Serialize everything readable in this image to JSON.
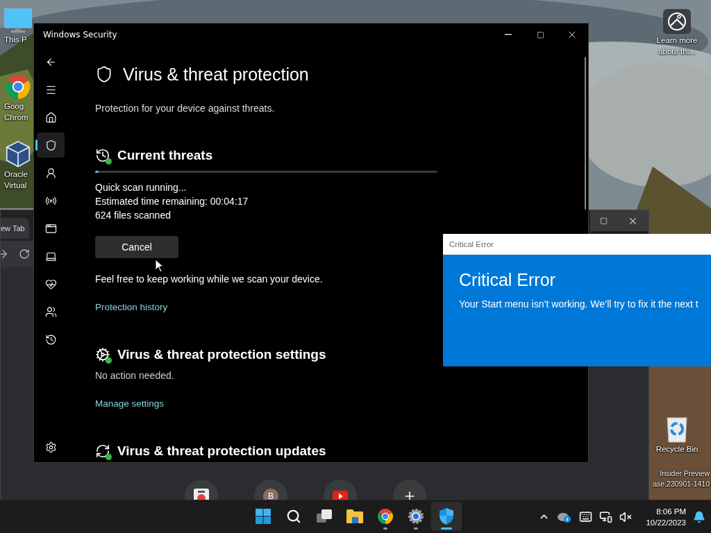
{
  "desktop": {
    "icons": [
      {
        "kind": "pc",
        "lines": [
          "This P"
        ]
      },
      {
        "kind": "chrome",
        "lines": [
          "Goog",
          "Chrom"
        ]
      },
      {
        "kind": "virtualbox",
        "lines": [
          "Oracle",
          "Virtual"
        ]
      },
      {
        "kind": "learn",
        "lines": [
          "Learn more",
          "about thi..."
        ]
      },
      {
        "kind": "recycle",
        "lines": [
          "Recycle Bin"
        ]
      }
    ],
    "watermark": [
      "Insider Preview",
      "ase.230901-1410"
    ]
  },
  "browser": {
    "tab": "ew Tab",
    "tiles": [
      {
        "kind": "site"
      },
      {
        "kind": "letter",
        "letter": "B"
      },
      {
        "kind": "video"
      },
      {
        "kind": "add"
      }
    ]
  },
  "security": {
    "title": "Windows Security",
    "nav": [
      {
        "kind": "back",
        "selected": false
      },
      {
        "kind": "menu",
        "selected": false
      },
      {
        "kind": "home",
        "selected": false
      },
      {
        "kind": "shield",
        "selected": true
      },
      {
        "kind": "account",
        "selected": false
      },
      {
        "kind": "network",
        "selected": false
      },
      {
        "kind": "app",
        "selected": false
      },
      {
        "kind": "device",
        "selected": false
      },
      {
        "kind": "health",
        "selected": false
      },
      {
        "kind": "family",
        "selected": false
      },
      {
        "kind": "history",
        "selected": false
      },
      {
        "kind": "settings",
        "selected": false
      }
    ],
    "heading": "Virus & threat protection",
    "subtitle": "Protection for your device against threats.",
    "sections": [
      {
        "kind": "threats",
        "title": "Current threats",
        "scan": {
          "level": 0.01,
          "lines": [
            "Quick scan running...",
            "Estimated time remaining: 00:04:17",
            "624 files scanned"
          ]
        },
        "button": "Cancel",
        "note": "Feel free to keep working while we scan your device.",
        "link": "Protection history"
      },
      {
        "kind": "settings",
        "title": "Virus & threat protection settings",
        "status": "No action needed.",
        "link": "Manage settings"
      },
      {
        "kind": "updates",
        "title": "Virus & threat protection updates"
      }
    ]
  },
  "error_dialog": {
    "title": "Critical Error",
    "heading": "Critical Error",
    "message": "Your Start menu isn’t working. We’ll try to fix it the next t"
  },
  "taskbar": {
    "apps": [
      {
        "kind": "start",
        "selected": false,
        "running": false
      },
      {
        "kind": "search",
        "selected": false,
        "running": false
      },
      {
        "kind": "taskview",
        "selected": false,
        "running": false
      },
      {
        "kind": "explorer",
        "selected": false,
        "running": false
      },
      {
        "kind": "chrome",
        "selected": false,
        "running": true
      },
      {
        "kind": "settings",
        "selected": false,
        "running": true
      },
      {
        "kind": "security",
        "selected": true,
        "running": true
      }
    ],
    "time": "8:06 PM",
    "date": "10/22/2023"
  }
}
